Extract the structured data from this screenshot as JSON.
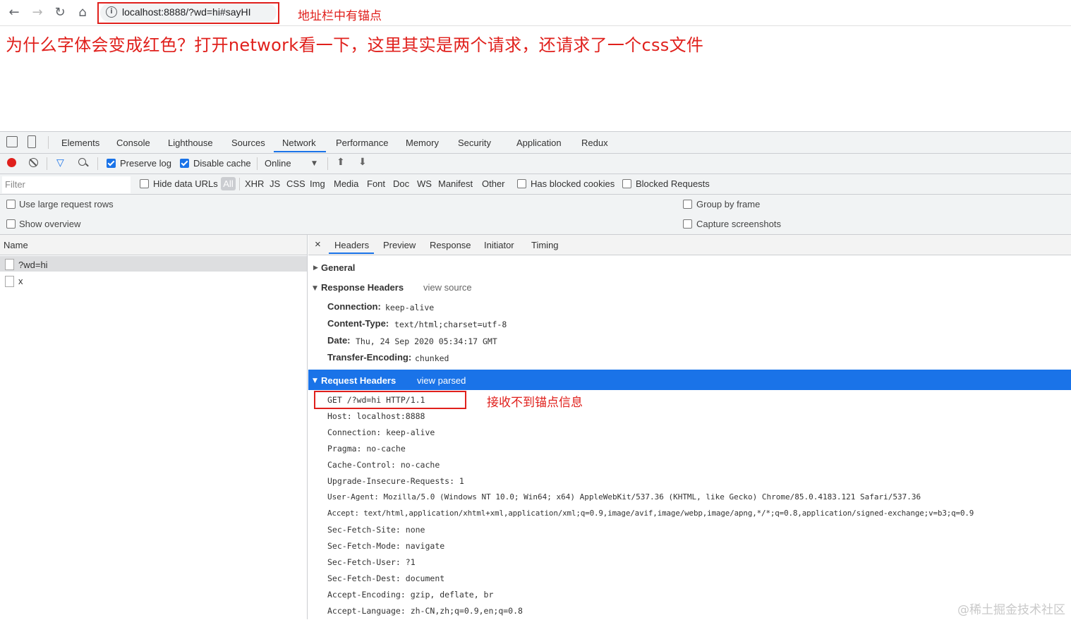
{
  "browser": {
    "url": "localhost:8888/?wd=hi#sayHI",
    "url_annotation": "地址栏中有锚点"
  },
  "page": {
    "heading": "为什么字体会变成红色？打开network看一下，这里其实是两个请求，还请求了一个css文件"
  },
  "devtools": {
    "tabs": [
      "Elements",
      "Console",
      "Lighthouse",
      "Sources",
      "Network",
      "Performance",
      "Memory",
      "Security",
      "Application",
      "Redux"
    ],
    "active_tab": "Network",
    "toolbar": {
      "preserve_log": "Preserve log",
      "disable_cache": "Disable cache",
      "throttle": "Online"
    },
    "filter": {
      "placeholder": "Filter",
      "hide_data_urls": "Hide data URLs",
      "types": [
        "All",
        "XHR",
        "JS",
        "CSS",
        "Img",
        "Media",
        "Font",
        "Doc",
        "WS",
        "Manifest",
        "Other"
      ],
      "has_blocked_cookies": "Has blocked cookies",
      "blocked_requests": "Blocked Requests"
    },
    "options": {
      "large_rows": "Use large request rows",
      "show_overview": "Show overview",
      "group_by_frame": "Group by frame",
      "capture_screenshots": "Capture screenshots"
    },
    "requests": {
      "header": "Name",
      "items": [
        "?wd=hi",
        "x"
      ]
    },
    "detail": {
      "close": "×",
      "tabs": [
        "Headers",
        "Preview",
        "Response",
        "Initiator",
        "Timing"
      ],
      "general": "General",
      "response_headers": {
        "title": "Response Headers",
        "link": "view source",
        "items": [
          {
            "key": "Connection:",
            "value": "keep-alive"
          },
          {
            "key": "Content-Type:",
            "value": "text/html;charset=utf-8"
          },
          {
            "key": "Date:",
            "value": "Thu, 24 Sep 2020 05:34:17 GMT"
          },
          {
            "key": "Transfer-Encoding:",
            "value": "chunked"
          }
        ]
      },
      "request_headers": {
        "title": "Request Headers",
        "link": "view parsed",
        "annotation": "接收不到锚点信息",
        "lines": [
          "GET /?wd=hi HTTP/1.1",
          "Host: localhost:8888",
          "Connection: keep-alive",
          "Pragma: no-cache",
          "Cache-Control: no-cache",
          "Upgrade-Insecure-Requests: 1",
          "User-Agent: Mozilla/5.0 (Windows NT 10.0; Win64; x64) AppleWebKit/537.36 (KHTML, like Gecko) Chrome/85.0.4183.121 Safari/537.36",
          "Accept: text/html,application/xhtml+xml,application/xml;q=0.9,image/avif,image/webp,image/apng,*/*;q=0.8,application/signed-exchange;v=b3;q=0.9",
          "Sec-Fetch-Site: none",
          "Sec-Fetch-Mode: navigate",
          "Sec-Fetch-User: ?1",
          "Sec-Fetch-Dest: document",
          "Accept-Encoding: gzip, deflate, br",
          "Accept-Language: zh-CN,zh;q=0.9,en;q=0.8"
        ]
      }
    }
  },
  "watermark": "@稀土掘金技术社区",
  "colors": {
    "accent": "#1a73e8",
    "annotation_red": "#e0201c"
  }
}
